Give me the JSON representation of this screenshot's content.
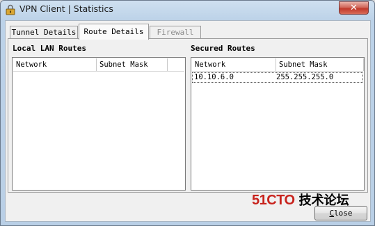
{
  "window": {
    "title": "VPN Client  |  Statistics",
    "close_glyph": "✕"
  },
  "tabs": [
    {
      "label": "Tunnel Details",
      "state": "normal"
    },
    {
      "label": "Route Details",
      "state": "selected"
    },
    {
      "label": "Firewall",
      "state": "disabled"
    }
  ],
  "local_routes": {
    "title": "Local LAN Routes",
    "columns": [
      "Network",
      "Subnet Mask"
    ],
    "rows": []
  },
  "secured_routes": {
    "title": "Secured Routes",
    "columns": [
      "Network",
      "Subnet Mask"
    ],
    "rows": [
      {
        "network": "10.10.6.0",
        "subnet_mask": "255.255.255.0"
      }
    ]
  },
  "watermark": {
    "brand": "51CTO",
    "suffix": "技术论坛"
  },
  "buttons": {
    "close_label": "Close",
    "close_mnemonic": "C",
    "close_rest": "lose"
  },
  "colors": {
    "brand_red": "#c8231d",
    "titlebar": "#bcd2e8"
  },
  "icons": {
    "app": "vpn-lock-icon",
    "window_close": "close-icon"
  }
}
